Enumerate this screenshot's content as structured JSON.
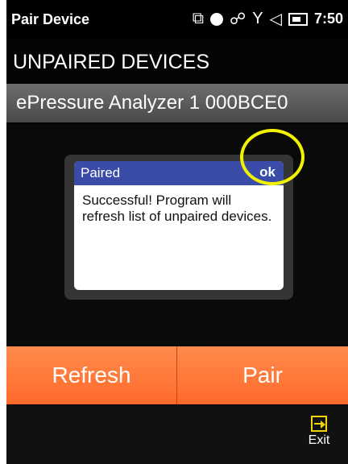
{
  "statusbar": {
    "title": "Pair Device",
    "time": "7:50",
    "icons": [
      "connection-icon",
      "dot-icon",
      "wifi-icon",
      "signal-icon",
      "volume-icon",
      "battery-icon"
    ]
  },
  "section": {
    "title": "UNPAIRED DEVICES"
  },
  "devices": [
    {
      "label": "ePressure Analyzer 1  000BCE0"
    }
  ],
  "dialog": {
    "title": "Paired",
    "ok_label": "ok",
    "message": "Successful! Program will refresh list of unpaired devices."
  },
  "buttons": {
    "refresh": "Refresh",
    "pair": "Pair"
  },
  "bottom": {
    "exit_label": "Exit"
  },
  "colors": {
    "accent_orange": "#ff6a2a",
    "dialog_blue": "#3b4ca8",
    "highlight_yellow": "#f2f200"
  }
}
